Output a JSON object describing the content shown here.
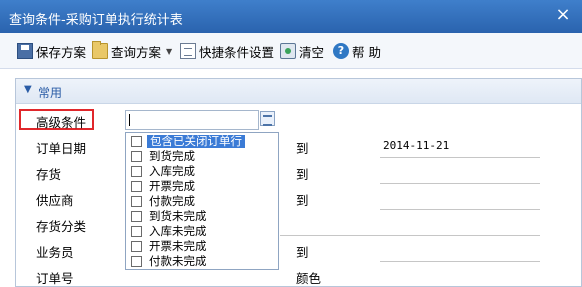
{
  "window": {
    "title": "查询条件-采购订单执行统计表",
    "close_glyph": "×"
  },
  "toolbar": {
    "save_scheme": "保存方案",
    "query_scheme": "查询方案",
    "quick_settings": "快捷条件设置",
    "clear": "清空",
    "help": "帮 助",
    "help_glyph": "?"
  },
  "panel": {
    "title": "常用"
  },
  "fields": {
    "advanced": "高级条件",
    "order_date": "订单日期",
    "inventory": "存货",
    "supplier": "供应商",
    "inventory_category": "存货分类",
    "salesperson": "业务员",
    "order_no": "订单号",
    "to": "到",
    "color": "颜色",
    "order_date_to_value": "2014-11-21"
  },
  "dropdown": {
    "options": [
      {
        "label": "包含已关闭订单行",
        "checked": false,
        "selected": true
      },
      {
        "label": "到货完成",
        "checked": false,
        "selected": false
      },
      {
        "label": "入库完成",
        "checked": false,
        "selected": false
      },
      {
        "label": "开票完成",
        "checked": false,
        "selected": false
      },
      {
        "label": "付款完成",
        "checked": false,
        "selected": false
      },
      {
        "label": "到货未完成",
        "checked": false,
        "selected": false
      },
      {
        "label": "入库未完成",
        "checked": false,
        "selected": false
      },
      {
        "label": "开票未完成",
        "checked": false,
        "selected": false
      },
      {
        "label": "付款未完成",
        "checked": false,
        "selected": false
      }
    ]
  },
  "colors": {
    "titlebar": "#2a63ae",
    "highlight_box": "#e0272b",
    "selection": "#3b7bd6",
    "panel_title": "#2a5ca6"
  }
}
